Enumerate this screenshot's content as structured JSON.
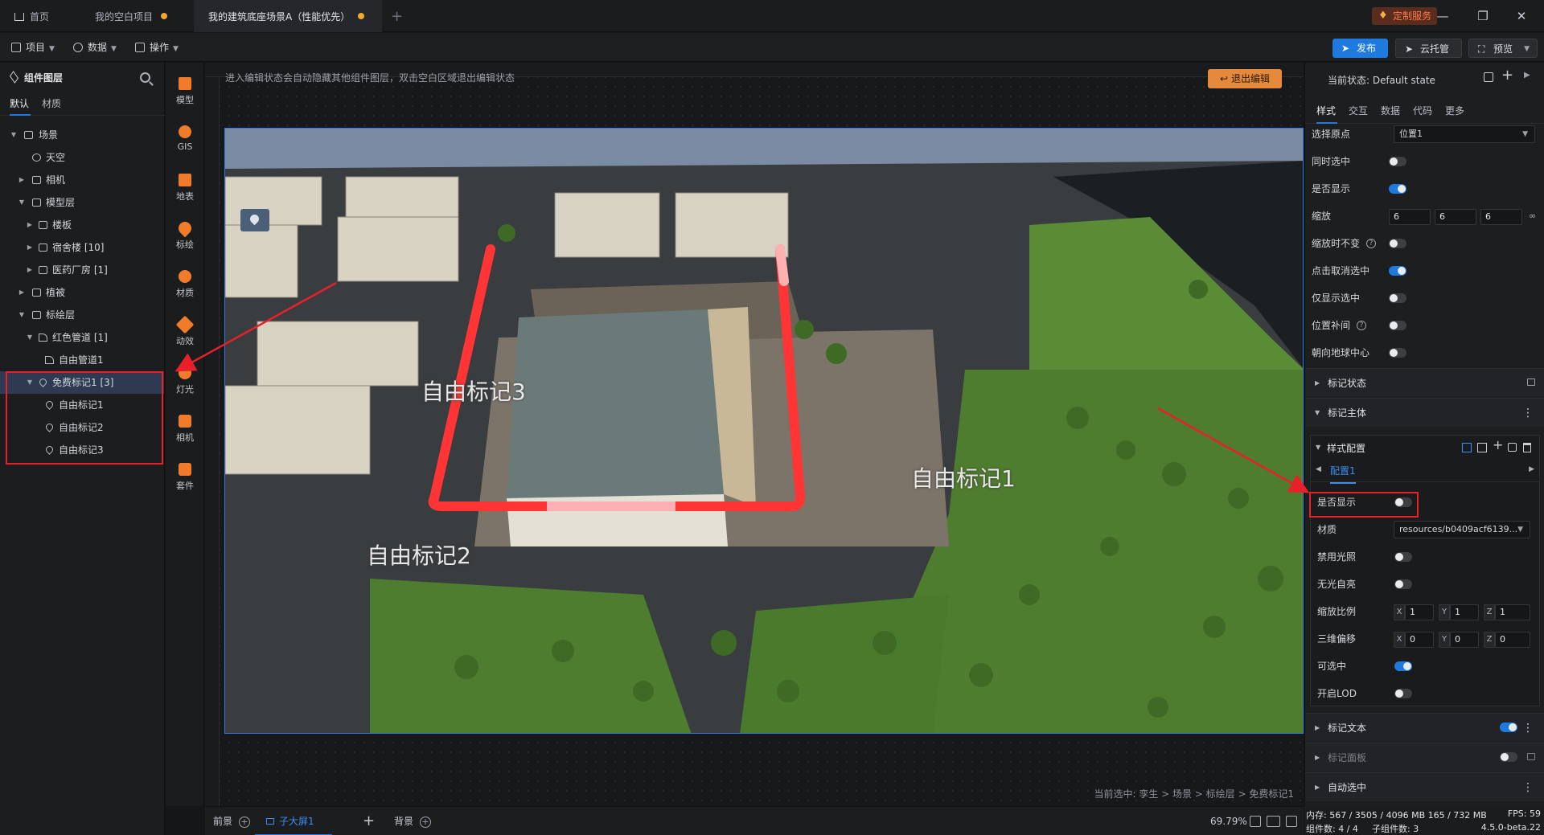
{
  "titlebar": {
    "tabs": [
      {
        "label": "首页"
      },
      {
        "label": "我的空白项目"
      },
      {
        "label": "我的建筑底座场景A（性能优先）"
      }
    ],
    "custom_service": "定制服务"
  },
  "menubar": {
    "menus": [
      "项目",
      "数据",
      "操作"
    ],
    "publish": "发布",
    "cloud": "云托管",
    "preview": "预览"
  },
  "layer_panel": {
    "title": "组件图层",
    "tabs": [
      "默认",
      "材质"
    ],
    "tree": [
      {
        "label": "场景"
      },
      {
        "label": "天空"
      },
      {
        "label": "相机"
      },
      {
        "label": "模型层"
      },
      {
        "label": "楼板"
      },
      {
        "label": "宿舍楼 [10]"
      },
      {
        "label": "医药厂房 [1]"
      },
      {
        "label": "植被"
      },
      {
        "label": "标绘层"
      },
      {
        "label": "红色管道 [1]"
      },
      {
        "label": "自由管道1"
      },
      {
        "label": "免费标记1 [3]"
      },
      {
        "label": "自由标记1"
      },
      {
        "label": "自由标记2"
      },
      {
        "label": "自由标记3"
      }
    ]
  },
  "tools": [
    "模型",
    "GIS",
    "地表",
    "标绘",
    "材质",
    "动效",
    "灯光",
    "相机",
    "套件"
  ],
  "canvas": {
    "hint": "进入编辑状态会自动隐藏其他组件图层，双击空白区域退出编辑状态",
    "exit_edit": "退出编辑",
    "markers": [
      "自由标记3",
      "自由标记1",
      "自由标记2"
    ],
    "breadcrumb": "当前选中: 孪生 > 场景 > 标绘层 > 免费标记1"
  },
  "bottom_bar": {
    "tabs": [
      "前景",
      "子大屏1",
      "背景"
    ],
    "zoom": "69.79%"
  },
  "prop_panel": {
    "state": "当前状态: Default state",
    "tabs": [
      "样式",
      "交互",
      "数据",
      "代码",
      "更多"
    ],
    "origin_label": "选择原点",
    "origin_value": "位置1",
    "rows": [
      {
        "label": "同时选中",
        "on": false
      },
      {
        "label": "是否显示",
        "on": true
      },
      {
        "label": "缩放"
      },
      {
        "label": "缩放时不变",
        "on": false
      },
      {
        "label": "点击取消选中",
        "on": true
      },
      {
        "label": "仅显示选中",
        "on": false
      },
      {
        "label": "位置补间",
        "on": false
      },
      {
        "label": "朝向地球中心",
        "on": false
      }
    ],
    "scale_values": [
      "6",
      "6",
      "6"
    ],
    "sections": {
      "marker_state": "标记状态",
      "marker_body": "标记主体",
      "style_config": "样式配置",
      "config_tab": "配置1",
      "marker_text": "标记文本",
      "marker_panel": "标记面板",
      "auto_select": "自动选中"
    },
    "config_rows": [
      {
        "label": "是否显示",
        "on": false
      },
      {
        "label": "材质"
      },
      {
        "label": "禁用光照",
        "on": false
      },
      {
        "label": "无光自亮",
        "on": false
      },
      {
        "label": "缩放比例"
      },
      {
        "label": "三维偏移"
      },
      {
        "label": "可选中",
        "on": true
      },
      {
        "label": "开启LOD",
        "on": false
      }
    ],
    "material_value": "resources/b0409acf6139...",
    "scale_ratio": {
      "x": "1",
      "y": "1",
      "z": "1"
    },
    "offset_3d": {
      "x": "0",
      "y": "0",
      "z": "0"
    }
  },
  "status": {
    "memory": "内存: 567 / 3505 / 4096 MB 165 / 732 MB",
    "fps": "FPS: 59",
    "components": "组件数: 4 / 4",
    "child_components": "子组件数: 3",
    "version": "4.5.0-beta.22"
  }
}
